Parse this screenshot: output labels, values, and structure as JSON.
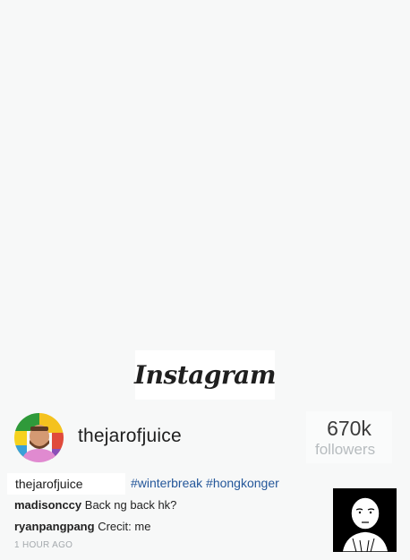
{
  "logo": {
    "text": "Instagram"
  },
  "profile": {
    "username": "thejarofjuice",
    "followers_count": "670k",
    "followers_label": "followers"
  },
  "post": {
    "caption_user": "thejarofjuice",
    "hashtags": "#winterbreak #hongkonger",
    "comments": [
      {
        "user": "madisonccy",
        "text": "Back ng back hk?"
      },
      {
        "user": "ryanpangpang",
        "text": "Crecit: me"
      }
    ],
    "timestamp": "1 HOUR AGO"
  },
  "colors": {
    "background": "#f7f8f8",
    "hashtag": "#24579a",
    "muted": "#b7bcbf"
  },
  "icons": {
    "avatar": "profile-photo",
    "thumbnail": "cartoon-character-image"
  }
}
